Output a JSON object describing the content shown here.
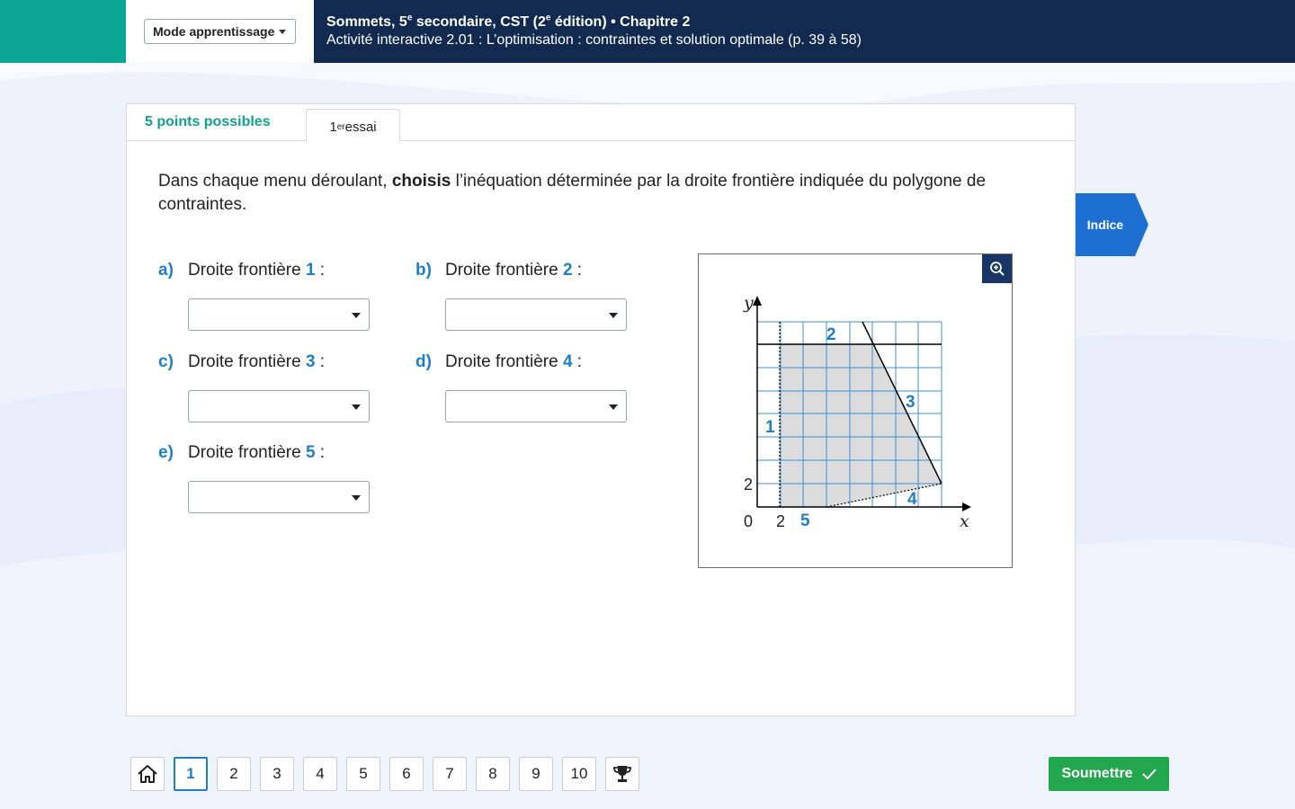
{
  "header": {
    "mode_select": "Mode apprentissage",
    "title_part1": "Sommets, 5",
    "title_sup1": "e",
    "title_part2": " secondaire, CST (2",
    "title_sup2": "e",
    "title_part3": " édition) • Chapitre 2",
    "subtitle": "Activité interactive 2.01 : L’optimisation : contraintes et solution optimale (p. 39 à 58)"
  },
  "card": {
    "points": "5 points possibles",
    "tab_num": "1",
    "tab_sup": "er",
    "tab_text": " essai",
    "instruction_pre": "Dans chaque menu déroulant, ",
    "instruction_bold": "choisis",
    "instruction_post": " l’inéquation déterminée par la droite frontière indiquée du polygone de contraintes."
  },
  "questions": [
    {
      "letter": "a)",
      "label": "Droite frontière ",
      "num": "1",
      "suffix": " :",
      "selected": ""
    },
    {
      "letter": "b)",
      "label": "Droite frontière ",
      "num": "2",
      "suffix": " :",
      "selected": ""
    },
    {
      "letter": "c)",
      "label": "Droite frontière ",
      "num": "3",
      "suffix": " :",
      "selected": ""
    },
    {
      "letter": "d)",
      "label": "Droite frontière ",
      "num": "4",
      "suffix": " :",
      "selected": ""
    },
    {
      "letter": "e)",
      "label": "Droite frontière ",
      "num": "5",
      "suffix": " :",
      "selected": ""
    }
  ],
  "figure": {
    "y_axis": "y",
    "x_axis": "x",
    "origin": "0",
    "x_tick": "2",
    "y_tick": "2",
    "line_labels": [
      "1",
      "2",
      "3",
      "4",
      "5"
    ],
    "zoom_icon": "zoom-in-icon"
  },
  "indice": "Indice",
  "nav": {
    "home_icon": "home-icon",
    "pages": [
      "1",
      "2",
      "3",
      "4",
      "5",
      "6",
      "7",
      "8",
      "9",
      "10"
    ],
    "active_page": "1",
    "trophy_icon": "trophy-icon"
  },
  "submit": "Soumettre",
  "colors": {
    "teal": "#0da596",
    "navy": "#132a50",
    "accent_blue": "#1f7fc6",
    "green": "#22a74f",
    "indice_blue": "#1e6fd2"
  }
}
